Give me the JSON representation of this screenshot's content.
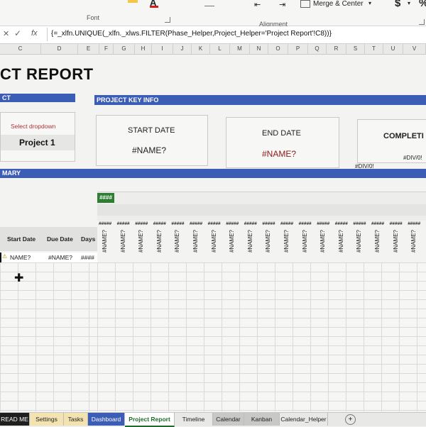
{
  "ribbon": {
    "font_group": "Font",
    "alignment_group": "Alignment",
    "merge_center": "Merge & Center",
    "currency": "$",
    "percent": "%"
  },
  "formula_bar": {
    "fx": "fx",
    "formula": "{=_xlfn.UNIQUE(_xlfn._xlws.FILTER(Phase_Helper,Project_Helper='Project Report'!C8))}"
  },
  "columns": [
    "C",
    "D",
    "E",
    "F",
    "G",
    "H",
    "I",
    "J",
    "K",
    "L",
    "M",
    "N",
    "O",
    "P",
    "Q",
    "R",
    "S",
    "T",
    "U",
    "V"
  ],
  "report": {
    "title": "CT REPORT",
    "left_bar": "CT",
    "key_info_bar": "PROJECT KEY INFO",
    "select_label": "Select dropdown",
    "project_value": "Project 1",
    "start_date_label": "START DATE",
    "start_date_value": "#NAME?",
    "end_date_label": "END DATE",
    "end_date_value": "#NAME?",
    "complete_label": "COMPLETI",
    "complete_pct": "#DIV/0!",
    "complete_value": "#DIV/0!",
    "summary_bar": "MARY",
    "timeline_badge": "####",
    "col_start": "Start Date",
    "col_due": "Due Date",
    "col_days": "Days",
    "row_start": "NAME?",
    "row_due": "#NAME?",
    "row_days": "####",
    "hash_label": "#####",
    "name_err": "#NAME?"
  },
  "tabs": [
    "READ ME",
    "Settings",
    "Tasks",
    "Dashboard",
    "Project Report",
    "Timeline",
    "Calendar",
    "Kanban",
    "Calendar_Helper"
  ],
  "active_tab": "Project Report",
  "colors": {
    "accent": "#3b5db6",
    "green": "#2e7d32",
    "error_red": "#8b1a1a"
  }
}
